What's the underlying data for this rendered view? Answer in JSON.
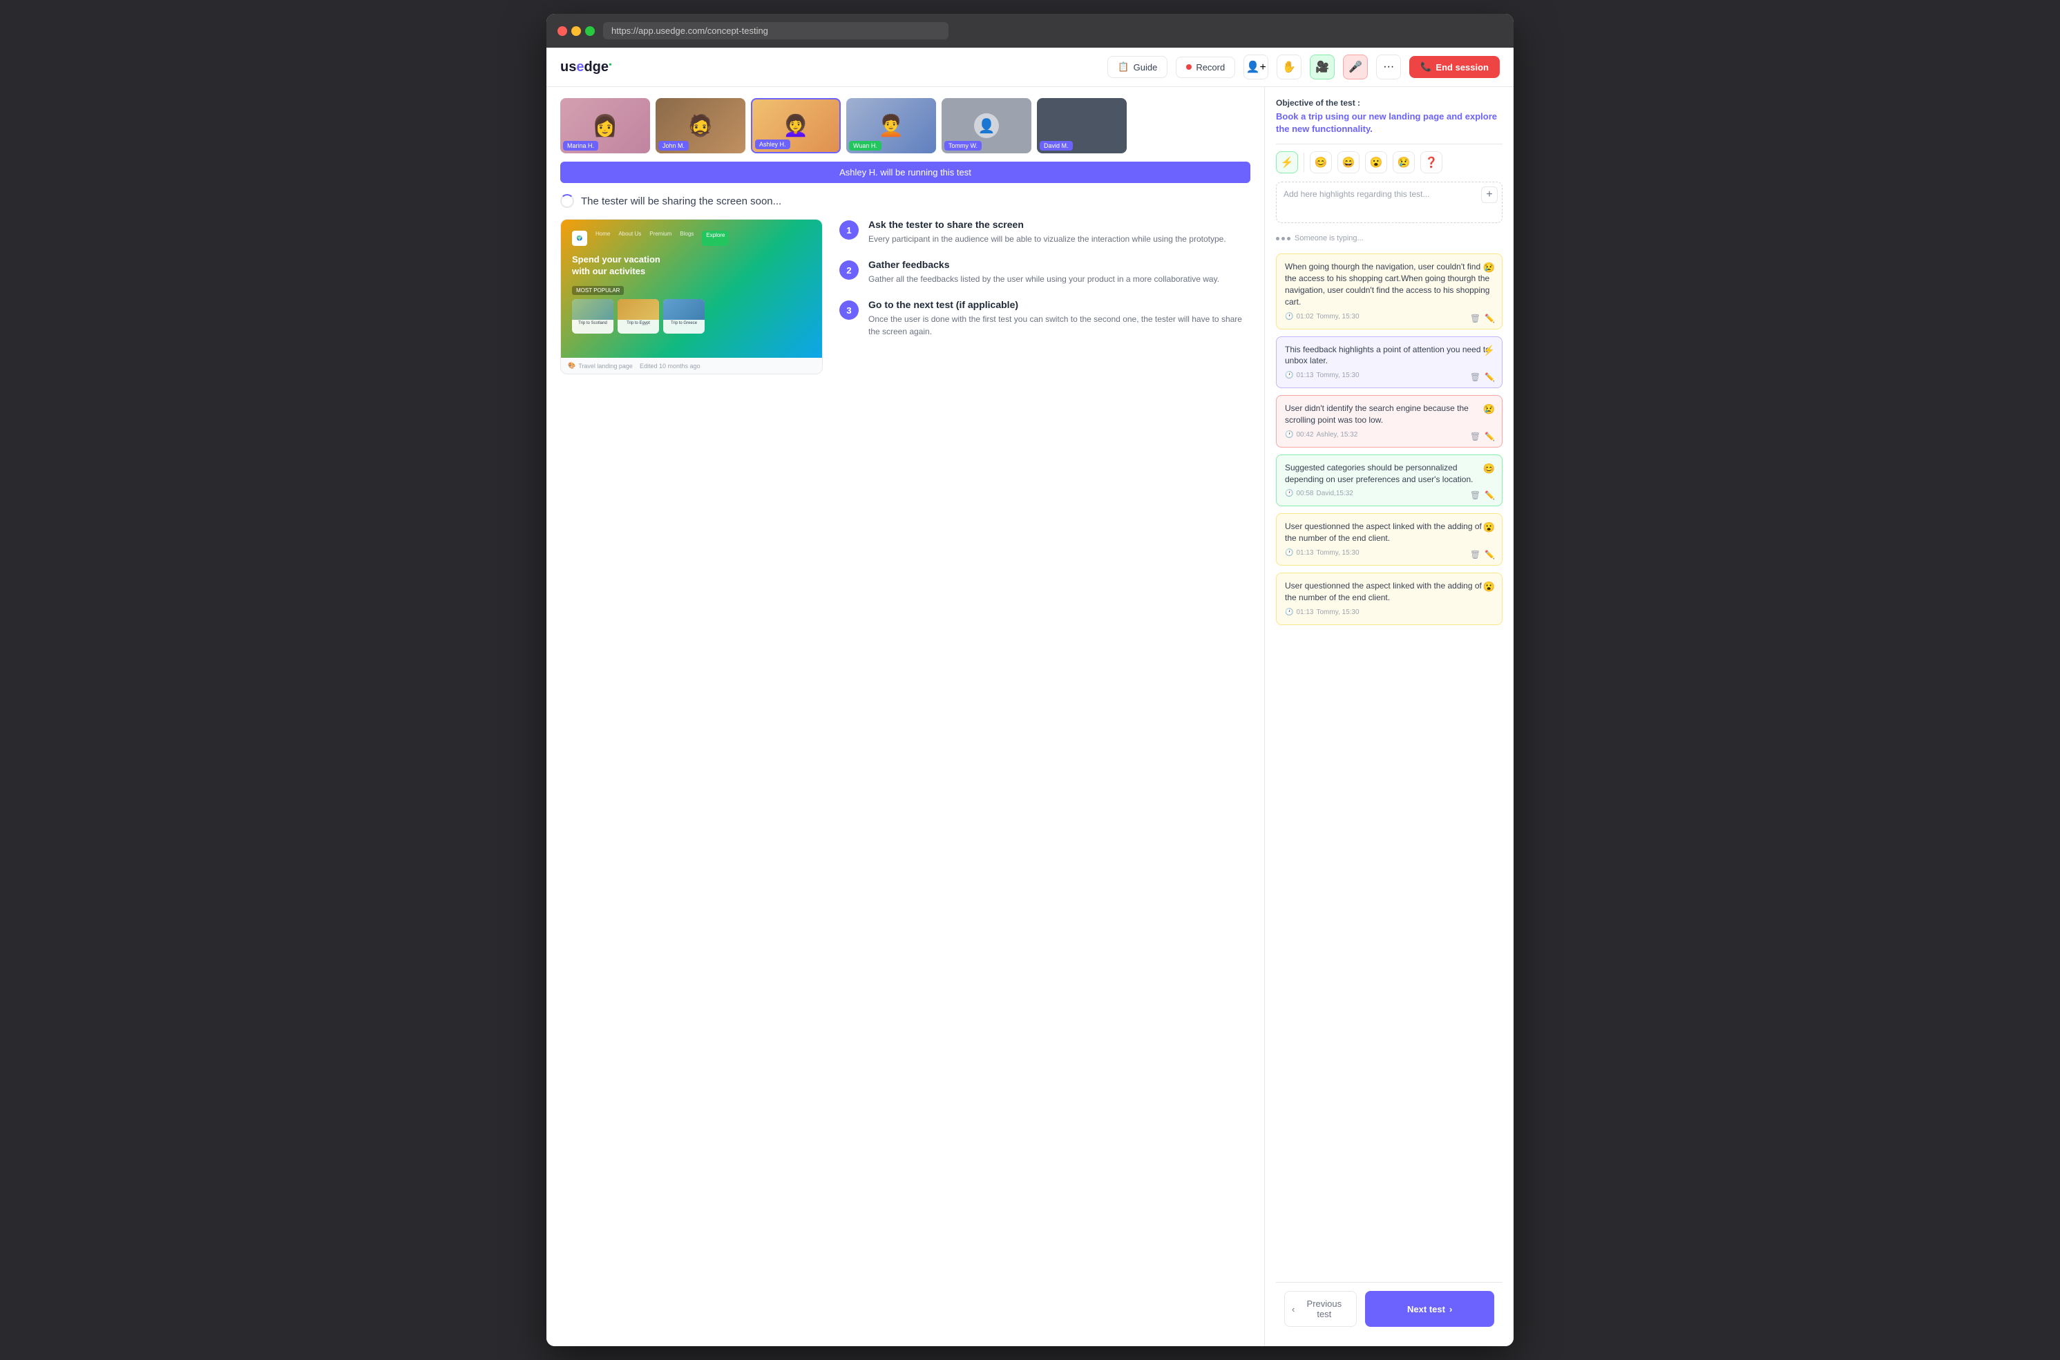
{
  "browser": {
    "url": "https://app.usedge.com/concept-testing"
  },
  "navbar": {
    "logo_text": "usedge",
    "guide_label": "Guide",
    "record_label": "Record",
    "end_session_label": "End session"
  },
  "participants": [
    {
      "name": "Marina H.",
      "color": "#6c63ff",
      "type": "photo"
    },
    {
      "name": "John M.",
      "color": "#6c63ff",
      "type": "photo"
    },
    {
      "name": "Ashley H.",
      "color": "#6c63ff",
      "type": "photo",
      "active": true
    },
    {
      "name": "Wuan H.",
      "color": "#6c63ff",
      "type": "photo"
    },
    {
      "name": "Tommy W.",
      "color": "#6c63ff",
      "type": "grey"
    },
    {
      "name": "David M.",
      "color": "#6c63ff",
      "type": "dark"
    }
  ],
  "banner": {
    "text": "Ashley H. will be running this test"
  },
  "sharing_message": "The tester will be sharing the screen soon...",
  "prototype": {
    "footer_text": "Travel landing page",
    "footer_sub": "Edited 10 months ago",
    "hero_line1": "Spend your vacation",
    "hero_line2": "with our activites",
    "nav_items": [
      "Home",
      "About Us",
      "Premium",
      "Blogs",
      "Explore"
    ],
    "card_labels": [
      "Trip to Scotland",
      "Trip to Egypt",
      "Trip to Greece"
    ],
    "most_popular": "MOST POPULAR"
  },
  "steps": [
    {
      "number": "1",
      "title": "Ask the tester to share the screen",
      "description": "Every participant in the audience will be able to vizualize the interaction while using the prototype."
    },
    {
      "number": "2",
      "title": "Gather feedbacks",
      "description": "Gather all the feedbacks listed by the user while using your product in a more collaborative way."
    },
    {
      "number": "3",
      "title": "Go to the next test (if applicable)",
      "description": "Once the user is done with the first test you can switch to the second one, the tester will have to share the screen again."
    }
  ],
  "right_panel": {
    "objective_label": "Objective of the test :",
    "objective_text": "Book a trip using our new landing page and explore the new functionnality.",
    "highlight_placeholder": "Add here highlights regarding this test...",
    "typing_text": "Someone is typing..."
  },
  "emojis": [
    "⚡",
    "😊",
    "😄",
    "😮",
    "😢",
    "❓"
  ],
  "feedbacks": [
    {
      "text": "When going thourgh the navigation, user couldn't find the access to his shopping cart.When going thourgh the navigation, user couldn't find the access to his shopping cart.",
      "time": "01:02",
      "author": "Tommy, 15:30",
      "emoji": "😢",
      "color": "yellow-bg"
    },
    {
      "text": "This feedback highlights a point of attention you need to unbox later.",
      "time": "01:13",
      "author": "Tommy, 15:30",
      "emoji": "⚡",
      "color": "purple-bg"
    },
    {
      "text": "User didn't identify the search engine because the scrolling point was too low.",
      "time": "00:42",
      "author": "Ashley, 15:32",
      "emoji": "😢",
      "color": "pink-bg"
    },
    {
      "text": "Suggested categories should be personnalized depending on user preferences and user's location.",
      "time": "00:58",
      "author": "David,15:32",
      "emoji": "😊",
      "color": "green-bg"
    },
    {
      "text": "User questionned the aspect linked with the adding of the number of the end client.",
      "time": "01:13",
      "author": "Tommy, 15:30",
      "emoji": "😮",
      "color": "yellow-bg"
    },
    {
      "text": "User questionned the aspect linked with the adding of the number of the end client.",
      "time": "01:13",
      "author": "Tommy, 15:30",
      "emoji": "😮",
      "color": "yellow-bg"
    }
  ],
  "bottom_nav": {
    "prev_label": "Previous test",
    "next_label": "Next test"
  }
}
